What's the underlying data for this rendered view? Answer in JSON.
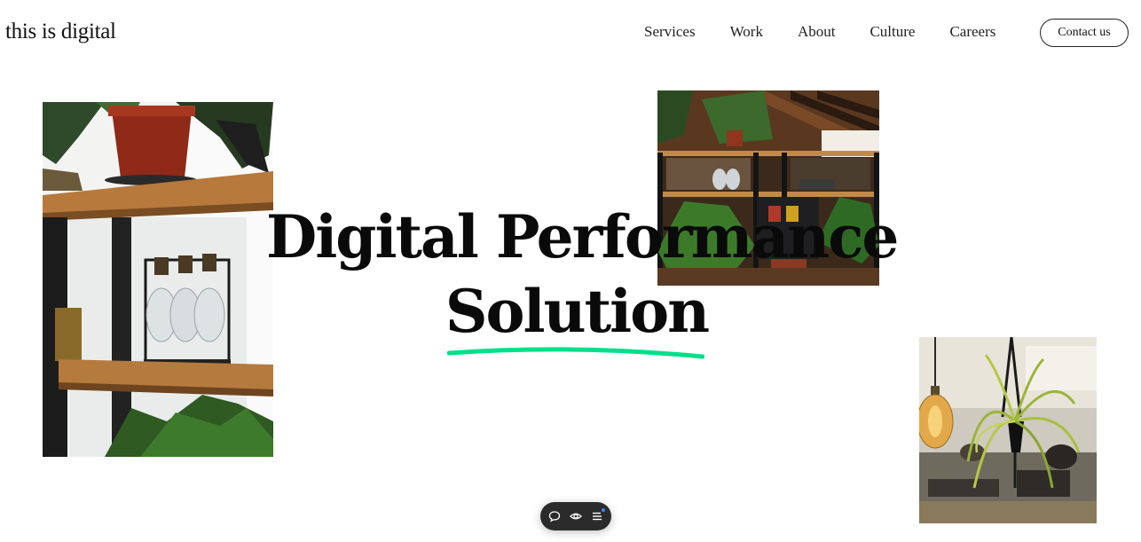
{
  "header": {
    "logo": "this is digital",
    "nav": [
      "Services",
      "Work",
      "About",
      "Culture",
      "Careers"
    ],
    "contact_label": "Contact us"
  },
  "hero": {
    "line1": "Digital Performance",
    "line2": "Solution",
    "underline_color": "#00e08a"
  },
  "images": {
    "shelf": "plant-shelf-photo",
    "office": "office-interior-photo",
    "hanging": "hanging-plant-photo"
  },
  "toolbar": {
    "icons": [
      "comment-icon",
      "eye-icon",
      "menu-icon"
    ],
    "bg_color": "#2b2b2b",
    "badge_color": "#3b82f6"
  }
}
